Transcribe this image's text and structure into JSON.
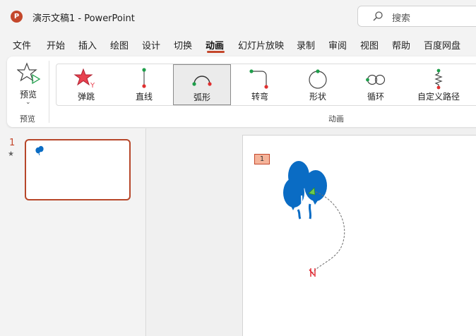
{
  "window": {
    "title": "演示文稿1  -  PowerPoint",
    "logo_letter": "P"
  },
  "search": {
    "placeholder": "搜索"
  },
  "menu": {
    "items": [
      "文件",
      "开始",
      "插入",
      "绘图",
      "设计",
      "切换",
      "动画",
      "幻灯片放映",
      "录制",
      "审阅",
      "视图",
      "帮助",
      "百度网盘"
    ],
    "active": "动画"
  },
  "ribbon": {
    "preview": {
      "label": "预览",
      "group_label": "预览"
    },
    "animation_group_label": "动画",
    "animations": [
      {
        "label": "弹跳",
        "icon": "bounce-icon"
      },
      {
        "label": "直线",
        "icon": "line-path-icon"
      },
      {
        "label": "弧形",
        "icon": "arc-path-icon",
        "selected": true
      },
      {
        "label": "转弯",
        "icon": "turn-path-icon"
      },
      {
        "label": "形状",
        "icon": "shape-path-icon"
      },
      {
        "label": "循环",
        "icon": "loop-path-icon"
      },
      {
        "label": "自定义路径",
        "icon": "custom-path-icon"
      }
    ]
  },
  "slides_pane": {
    "slide_number": "1",
    "star": "★"
  },
  "slide": {
    "animation_tag": "1"
  },
  "colors": {
    "accent": "#c4472b",
    "balloon": "#0a6cc4"
  }
}
